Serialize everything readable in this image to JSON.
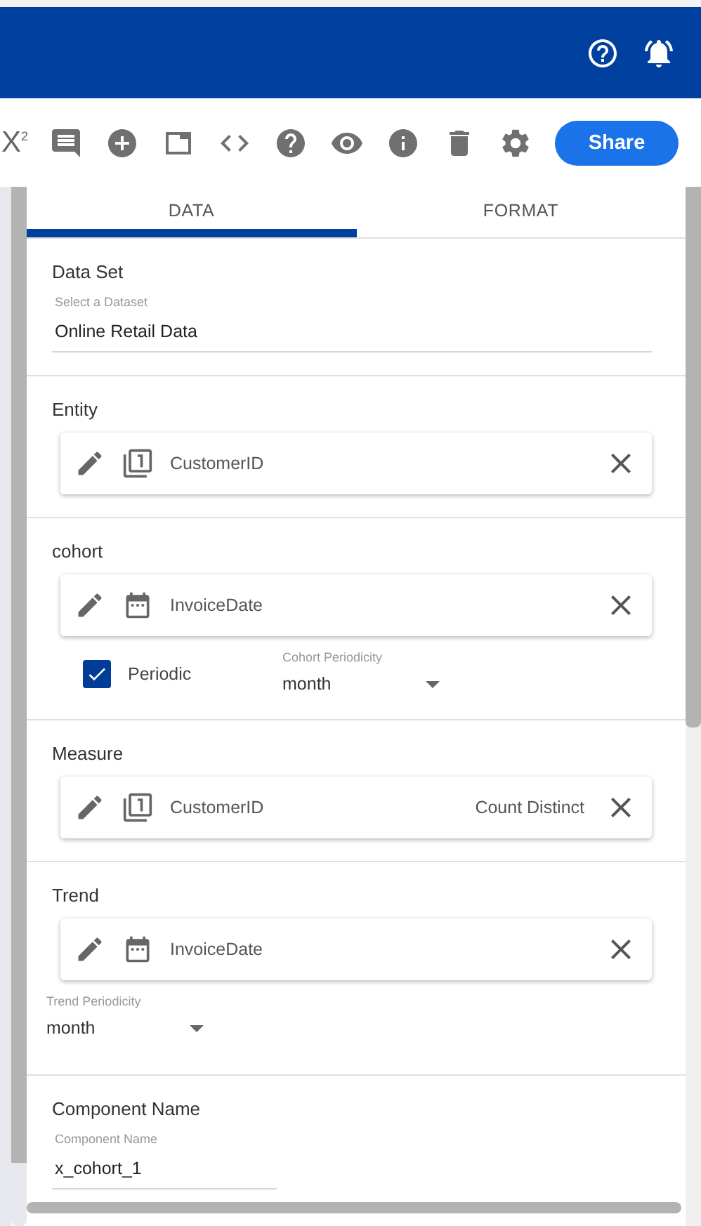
{
  "toolbar": {
    "formula_label": "X$^{2}$",
    "share_button": "Share"
  },
  "tabs": [
    {
      "label": "DATA",
      "selected": true
    },
    {
      "label": "FORMAT",
      "selected": false
    }
  ],
  "sections": [
    {
      "kind": "select",
      "title": "Data Set",
      "field_label": "Select a Dataset",
      "value": "Online Retail Data"
    },
    {
      "kind": "field",
      "title": "Entity",
      "chip": {
        "kind": "number",
        "name": "CustomerID"
      }
    },
    {
      "kind": "field",
      "title": "cohort",
      "chip": {
        "kind": "date",
        "name": "InvoiceDate"
      },
      "checkbox": {
        "label": "Periodic",
        "checked": true
      },
      "periodicity": {
        "label": "Cohort Periodicity",
        "value": "month"
      }
    },
    {
      "kind": "field",
      "title": "Measure",
      "chip": {
        "kind": "number",
        "name": "CustomerID",
        "aggregation": "Count Distinct"
      }
    },
    {
      "kind": "field",
      "title": "Trend",
      "chip": {
        "kind": "date",
        "name": "InvoiceDate"
      },
      "periodicity": {
        "label": "Trend Periodicity",
        "value": "month"
      }
    },
    {
      "kind": "text",
      "title": "Component Name",
      "field_label": "Component Name",
      "value": "x_cohort_1"
    }
  ]
}
